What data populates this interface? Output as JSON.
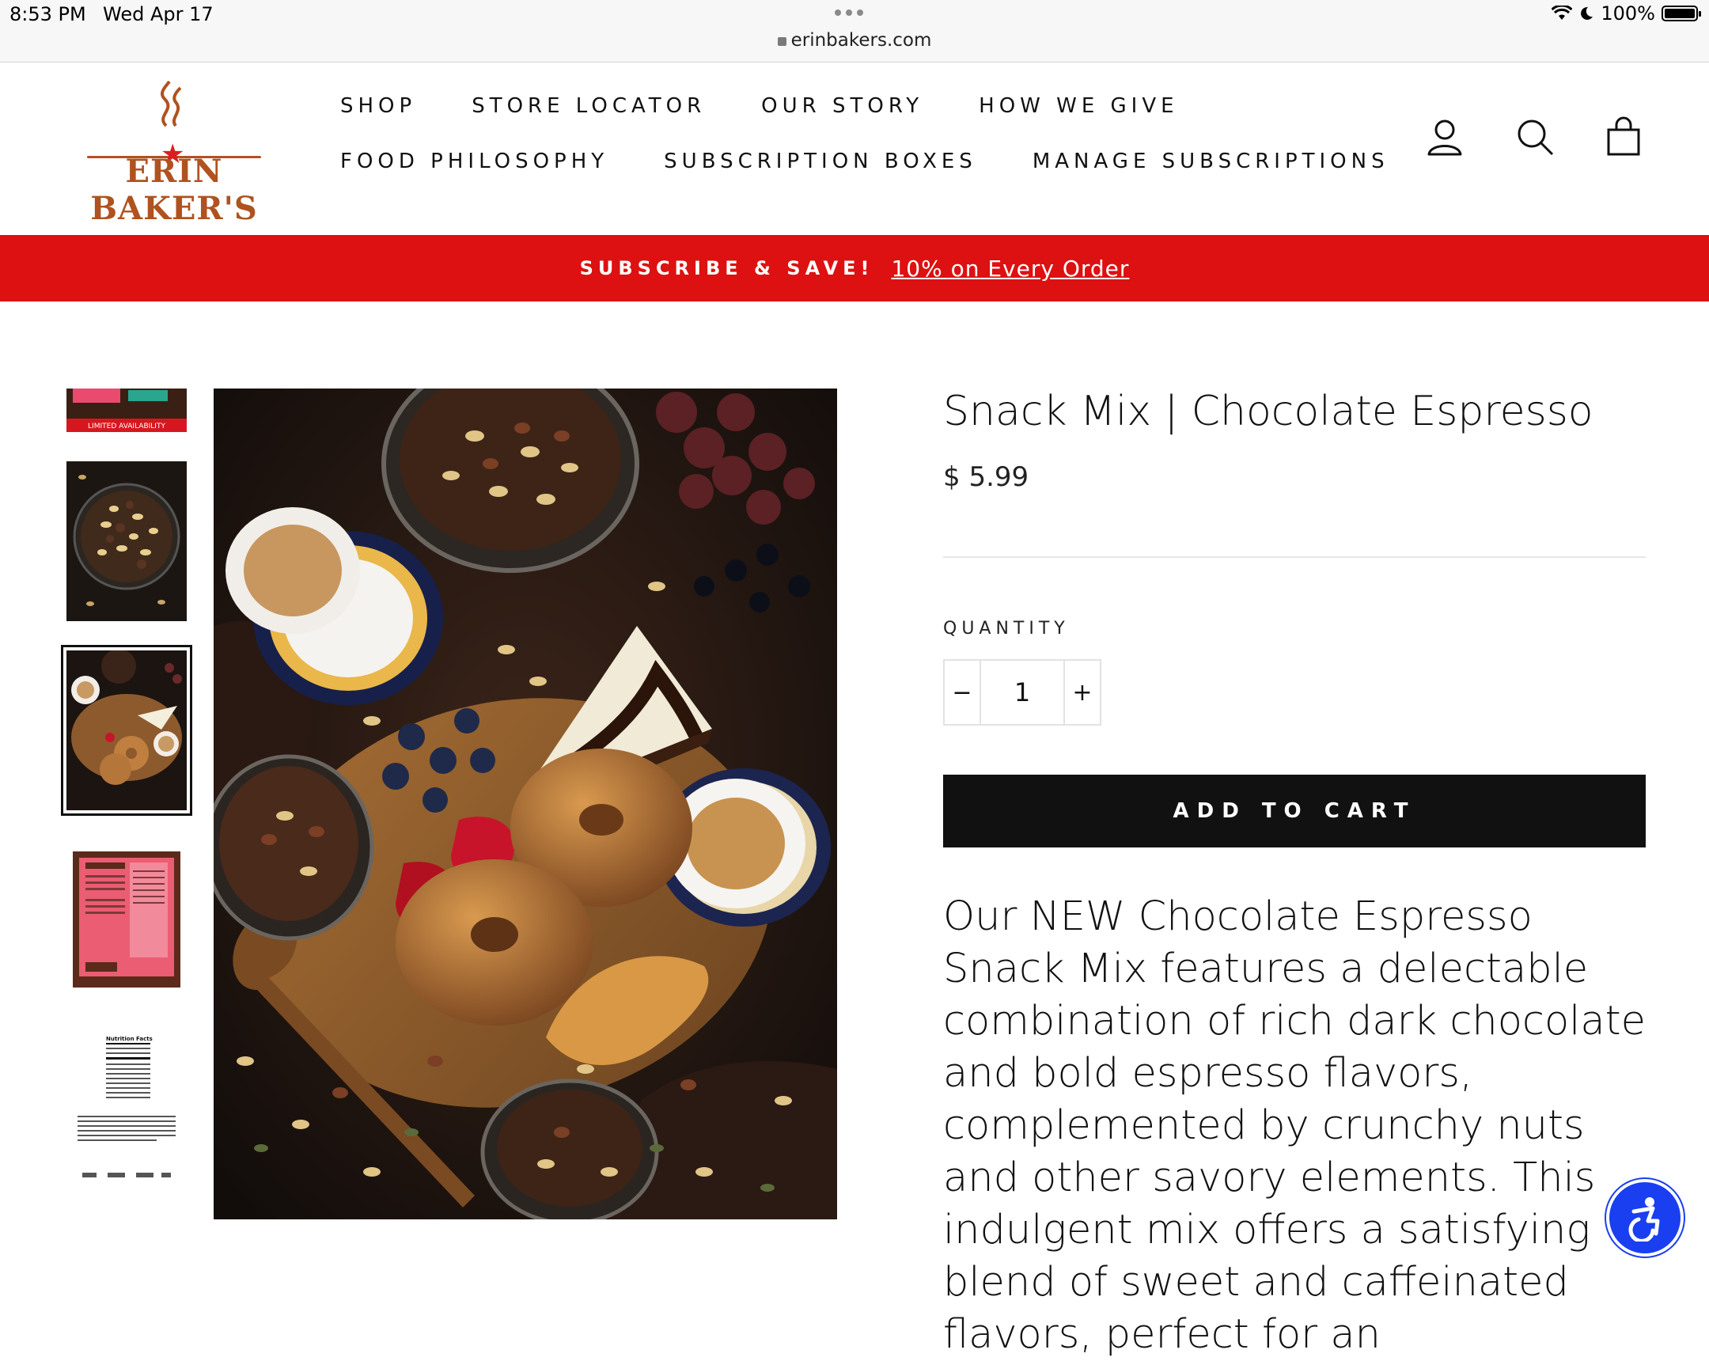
{
  "status_bar": {
    "time": "8:53 PM",
    "date": "Wed Apr 17",
    "url": "erinbakers.com",
    "battery": "100%"
  },
  "brand": {
    "logo_text": "ERIN BAKER'S",
    "accent": "#b0521f",
    "star_color": "#d81f1f"
  },
  "nav": {
    "row1": [
      "SHOP",
      "STORE LOCATOR",
      "OUR STORY",
      "HOW WE GIVE"
    ],
    "row2": [
      "FOOD PHILOSOPHY",
      "SUBSCRIPTION BOXES",
      "MANAGE SUBSCRIPTIONS"
    ],
    "icons": [
      "account-icon",
      "search-icon",
      "cart-icon"
    ]
  },
  "promo": {
    "strong": "SUBSCRIBE & SAVE!",
    "link": "10% on Every Order",
    "background": "#dd1111"
  },
  "gallery": {
    "thumbnails": [
      {
        "name": "package-front",
        "badge_text": "LIMITED AVAILABILITY",
        "selected": false
      },
      {
        "name": "snack-bowl",
        "selected": false
      },
      {
        "name": "breakfast-spread",
        "selected": true
      },
      {
        "name": "package-back",
        "selected": false
      },
      {
        "name": "nutrition-facts",
        "label": "Nutrition Facts",
        "selected": false
      }
    ]
  },
  "product": {
    "title": "Snack Mix | Chocolate Espresso",
    "price": "$ 5.99",
    "quantity_label": "QUANTITY",
    "quantity": "1",
    "minus": "−",
    "plus": "+",
    "add_to_cart": "ADD TO CART",
    "description": "Our NEW Chocolate Espresso Snack Mix features a delectable combination of rich dark chocolate and bold espresso flavors, complemented by crunchy nuts and other savory elements. This indulgent mix offers a satisfying blend of sweet and caffeinated flavors, perfect for an"
  },
  "accessibility": {
    "icon": "accessibility-icon",
    "color": "#1a3ff0"
  }
}
